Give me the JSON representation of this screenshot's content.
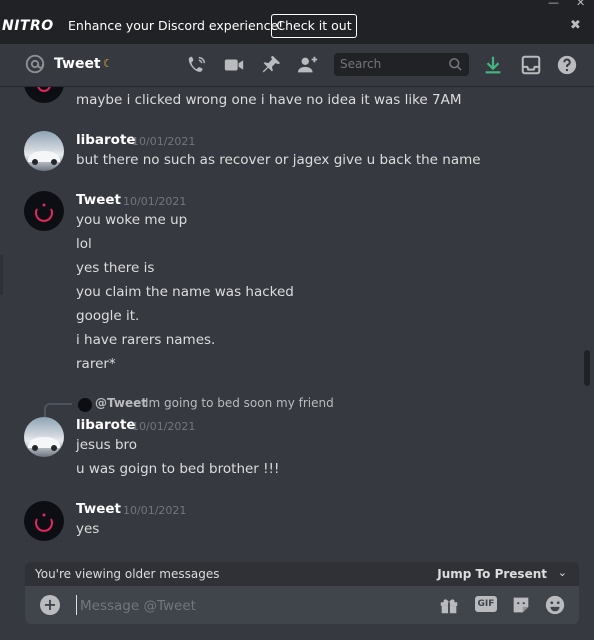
{
  "window": {
    "minimize_glyph": "—",
    "close_glyph": "✕"
  },
  "nitro": {
    "logo": "NITRO",
    "message": "Enhance your Discord experience!",
    "cta": "Check it out",
    "close_glyph": "✖"
  },
  "header": {
    "channel_name": "Tweet",
    "status_glyph": "☾",
    "search_placeholder": "Search",
    "download_color": "#43b581"
  },
  "messages": [
    {
      "type": "continuation",
      "text": "maybe i clicked wrong one i have no idea it was like 7AM"
    },
    {
      "type": "group",
      "author": "libarote",
      "timestamp": "10/01/2021",
      "avatar": "car-avatar",
      "lines": [
        "but there no such as recover or jagex give u back the name"
      ]
    },
    {
      "type": "group",
      "author": "Tweet",
      "timestamp": "10/01/2021",
      "avatar": "dark-avatar",
      "lines": [
        "you woke me up",
        "lol",
        "yes there is",
        "you claim the name was hacked",
        "google it.",
        "i have rarers names.",
        "rarer*"
      ]
    },
    {
      "type": "reply",
      "reply_to": "@Tweet",
      "reply_text": "Im going to bed soon my friend",
      "author": "libarote",
      "timestamp": "10/01/2021",
      "avatar": "car-avatar",
      "lines": [
        "jesus bro",
        "u was goign to bed brother !!!"
      ]
    },
    {
      "type": "group",
      "author": "Tweet",
      "timestamp": "10/01/2021",
      "avatar": "dark-avatar",
      "lines": [
        "yes"
      ]
    }
  ],
  "older_bar": {
    "text": "You're viewing older messages",
    "jump_label": "Jump To Present",
    "chevron": "⌄"
  },
  "composer": {
    "plus": "+",
    "placeholder": "Message @Tweet",
    "gif_label": "GIF"
  }
}
